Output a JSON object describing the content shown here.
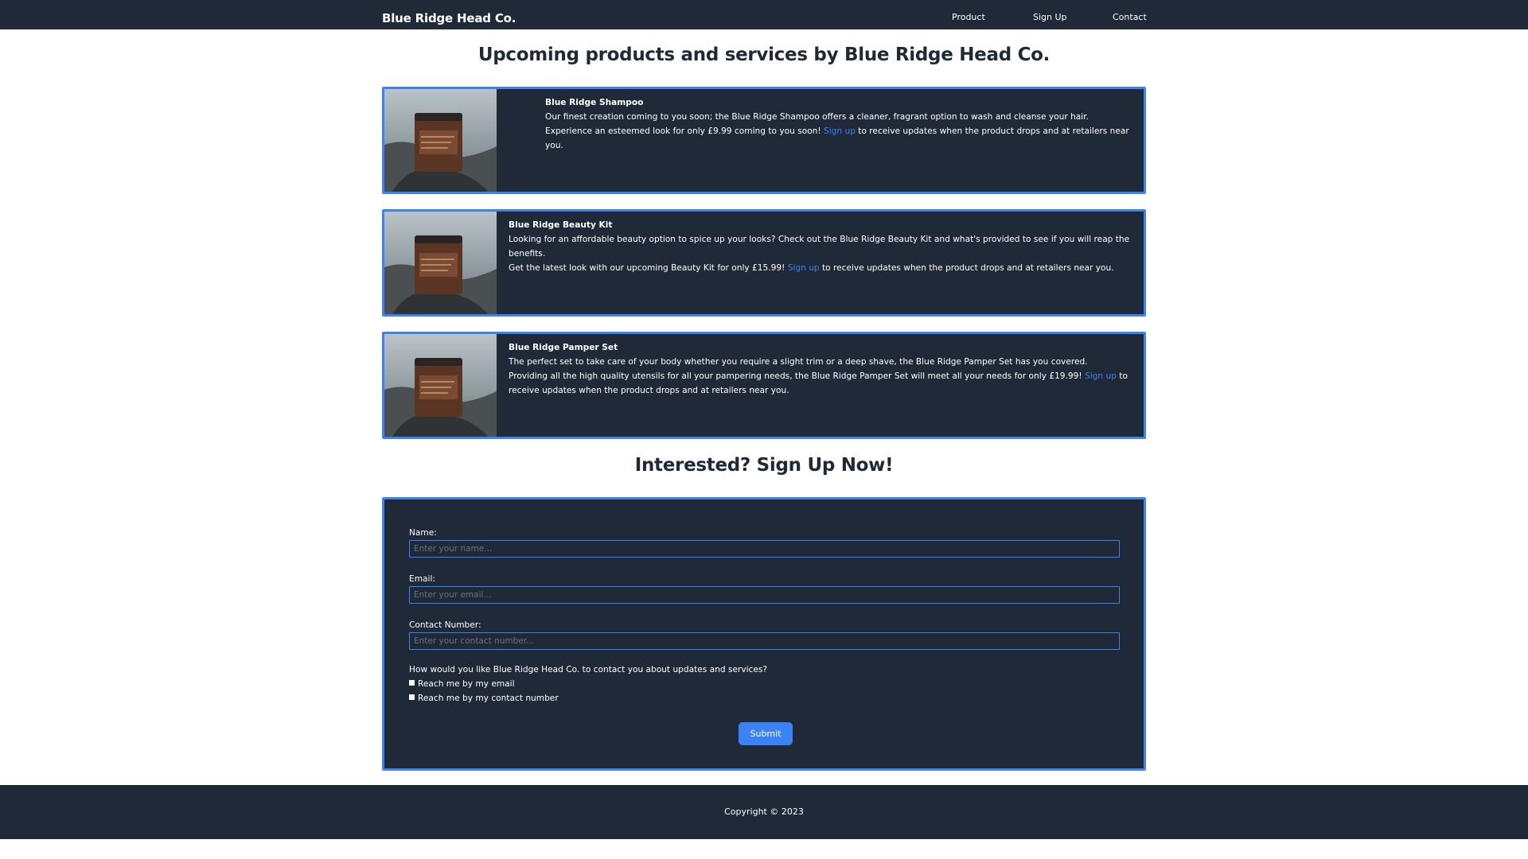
{
  "header": {
    "brand": "Blue Ridge Head Co.",
    "nav": [
      "Product",
      "Sign Up",
      "Contact"
    ]
  },
  "main": {
    "title": "Upcoming products and services by Blue Ridge Head Co.",
    "products": [
      {
        "name": "Blue Ridge Shampoo",
        "line1": "Our finest creation coming to you soon; the Blue Ridge Shampoo offers a cleaner, fragrant option to wash and cleanse your hair.",
        "line2_before": "Experience an esteemed look for only £9.99 coming to you soon! ",
        "link": "Sign up",
        "line2_after": " to receive updates when the product drops and at retailers near you."
      },
      {
        "name": "Blue Ridge Beauty Kit",
        "line1": "Looking for an affordable beauty option to spice up your looks? Check out the Blue Ridge Beauty Kit and what's provided to see if you will reap the benefits.",
        "line2_before": "Get the latest look with our upcoming Beauty Kit for only £15.99! ",
        "link": "Sign up",
        "line2_after": " to receive updates when the product drops and at retailers near you."
      },
      {
        "name": "Blue Ridge Pamper Set",
        "line1": "The perfect set to take care of your body whether you require a slight trim or a deep shave, the Blue Ridge Pamper Set has you covered.",
        "line2_before": "Providing all the high quality utensils for all your pampering needs, the Blue Ridge Pamper Set will meet all your needs for only £19.99! ",
        "link": "Sign up",
        "line2_after": " to receive updates when the product drops and at retailers near you."
      }
    ]
  },
  "signup": {
    "title": "Interested? Sign Up Now!",
    "name_label": "Name:",
    "name_placeholder": "Enter your name...",
    "email_label": "Email:",
    "email_placeholder": "Enter your email...",
    "phone_label": "Contact Number:",
    "phone_placeholder": "Enter your contact number...",
    "question": "How would you like Blue Ridge Head Co. to contact you about updates and services?",
    "options": [
      "Reach me by my email",
      "Reach me by my contact number"
    ],
    "submit": "Submit"
  },
  "footer": {
    "copyright": "Copyright © 2023"
  },
  "colors": {
    "navy": "#1f2937",
    "accent": "#3b82f6",
    "white": "#ffffff"
  }
}
